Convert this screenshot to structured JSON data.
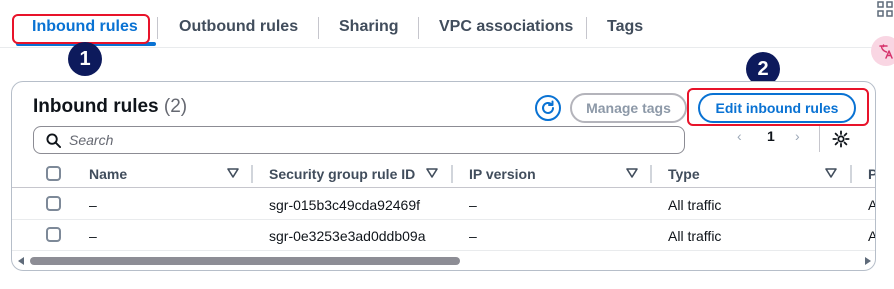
{
  "tabs": [
    {
      "label": "Inbound rules",
      "active": true
    },
    {
      "label": "Outbound rules",
      "active": false
    },
    {
      "label": "Sharing",
      "active": false
    },
    {
      "label": "VPC associations",
      "active": false
    },
    {
      "label": "Tags",
      "active": false
    }
  ],
  "annotations": {
    "step1": "1",
    "step2": "2",
    "highlight_color": "#e8132a"
  },
  "panel": {
    "title": "Inbound rules",
    "count": "(2)",
    "refresh_icon": "refresh-icon",
    "manage_tags_label": "Manage tags",
    "edit_rules_label": "Edit inbound rules",
    "search_placeholder": "Search",
    "page_prev": "‹",
    "page_current": "1",
    "page_next": "›"
  },
  "table": {
    "columns": [
      "Name",
      "Security group rule ID",
      "IP version",
      "Type",
      "P"
    ],
    "rows": [
      {
        "name": "–",
        "rule_id": "sgr-015b3c49cda92469f",
        "ip_version": "–",
        "type": "All traffic",
        "protocol": "A"
      },
      {
        "name": "–",
        "rule_id": "sgr-0e3253e3ad0ddb09a",
        "ip_version": "–",
        "type": "All traffic",
        "protocol": "A"
      }
    ]
  },
  "colors": {
    "accent": "#0972d3",
    "text": "#0f141a",
    "muted": "#414d5c"
  }
}
